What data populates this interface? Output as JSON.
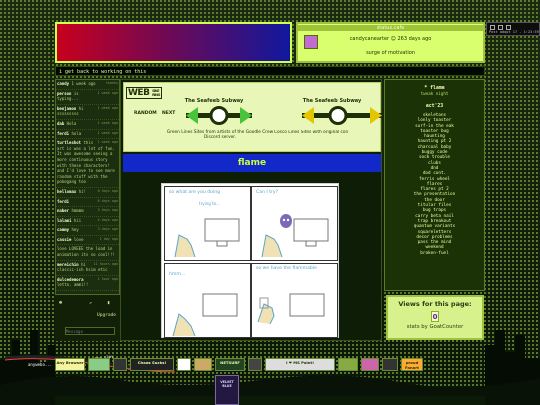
{
  "status": {
    "title": "status.cafe",
    "user": "candycanearter",
    "days_ago": "263 days ago",
    "text": "surge of motivation"
  },
  "window": {
    "clock": "Post adopt 17 - 1:23:39"
  },
  "announcement": "i get back to working on this",
  "chat": {
    "messages": [
      {
        "name": "candy",
        "time": "thanks",
        "text": "1 week ago"
      },
      {
        "name": "person",
        "time": "1 week ago",
        "text": "is typing..."
      },
      {
        "name": "benjamon",
        "time": "1 week ago",
        "text": "hi sssssssss"
      },
      {
        "name": "dab",
        "time": "1 week ago",
        "text": "Hola"
      },
      {
        "name": "ferdi",
        "time": "1 week ago",
        "text": "hola"
      },
      {
        "name": "turtleshot",
        "time": "1 week ago",
        "text": "this art is was a lot of fun. It was awesome seeing a more continuous story with these characters! and I'd love to see more random stuff with the pokegang too"
      },
      {
        "name": "hellomax",
        "time": "6 days ago",
        "text": "hi!"
      },
      {
        "name": "ferdi",
        "time": "6 days ago",
        "text": ""
      },
      {
        "name": "naber",
        "time": "5 days ago",
        "text": "hmmmm"
      },
      {
        "name": "lalami",
        "time": "4 days ago",
        "text": "hii"
      },
      {
        "name": "cammy",
        "time": "3 days ago",
        "text": "hey"
      },
      {
        "name": "cassie",
        "time": "1 day ago",
        "text": "love"
      },
      {
        "name": "",
        "time": "",
        "text": "love LOVEEE the load in animation its so cool!!!"
      },
      {
        "name": "mereichin",
        "time": "11 hours ago",
        "text": "hi classic-ish hsim etic"
      },
      {
        "name": "dulcedemora",
        "time": "1 hour ago",
        "text": "letto. ammi!!"
      }
    ],
    "upgrade": "Upgrade",
    "message_placeholder": "Message"
  },
  "webring": {
    "logo": "WEB",
    "logo_small_1": "SIKE",
    "logo_small_2": "RING",
    "random": "RANDOM",
    "next": "NEXT",
    "left_site": "The Seafeeb Subway",
    "right_site": "The Seafeeb Subway",
    "left_desc": "Green Lines Sites from artists of the Goodle Crew Discord server.",
    "right_desc": "Cosco Lines Sites with original con"
  },
  "section_title": "flame",
  "comic": {
    "p1_caption": "so what are you doing",
    "p1_sub": "trying to...",
    "p2_caption": "Can I try?",
    "p3_caption": "hmm...",
    "p4_caption": "so we have the flammable"
  },
  "rightcol": {
    "title": "* flame",
    "subtitle": "tweak night",
    "act": "act'23",
    "items": [
      "skeletons",
      "lonly toaster",
      "surf-in the eak",
      "toaster bug",
      "haunting",
      "haunting pt 2",
      "charcoal baby",
      "buggy code",
      "sock trouble",
      "clubs",
      "dnd",
      "dod cont.",
      "ferris wheel",
      "flares",
      "flares pt 2",
      "the presentation",
      "the door",
      "titular files",
      "bug traps",
      "carry beta nail",
      "trap breakout",
      "quantum variants",
      "squareletters",
      "decor problems",
      "pass the mind",
      "weekend",
      "broken-fuel"
    ]
  },
  "views": {
    "title": "Views for this page:",
    "count": "0",
    "credit": "stats by GoatCounter"
  },
  "bottom": {
    "stop_label": "stop play",
    "ticker": "anywebo...",
    "stamps": [
      "Any Browser",
      "",
      "",
      "Chaos Sucks!",
      "",
      "",
      "NETSURF",
      "",
      "I ❤ MS Paint!",
      "",
      "",
      "",
      "proud Fanart"
    ],
    "album": "VELVET BLUE"
  }
}
